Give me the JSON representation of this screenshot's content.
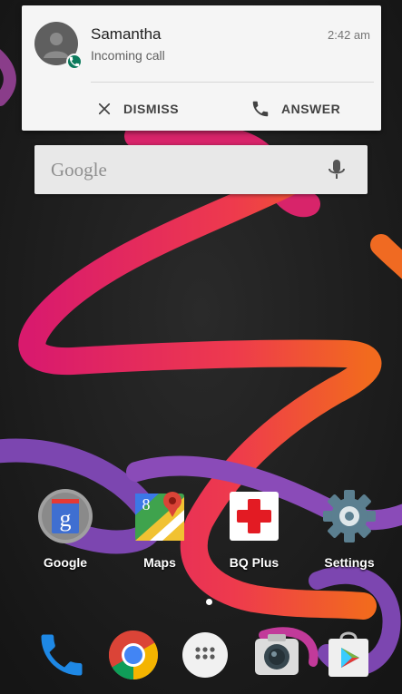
{
  "notification": {
    "name": "Samantha",
    "subtitle": "Incoming call",
    "time": "2:42 am",
    "dismiss_label": "DISMISS",
    "answer_label": "ANSWER"
  },
  "search": {
    "logo": "Google"
  },
  "apps": [
    {
      "label": "Google",
      "icon": "google-search-icon"
    },
    {
      "label": "Maps",
      "icon": "maps-icon"
    },
    {
      "label": "BQ Plus",
      "icon": "bq-plus-icon"
    },
    {
      "label": "Settings",
      "icon": "gear-icon"
    }
  ],
  "dock": [
    {
      "icon": "phone-icon"
    },
    {
      "icon": "chrome-icon"
    },
    {
      "icon": "app-drawer-icon"
    },
    {
      "icon": "camera-icon"
    },
    {
      "icon": "play-store-icon"
    }
  ],
  "colors": {
    "accent": "#0b7a5c",
    "wallpaper_pink": "#e6206a",
    "wallpaper_orange": "#f2521e",
    "wallpaper_purple": "#8a4bb8"
  }
}
